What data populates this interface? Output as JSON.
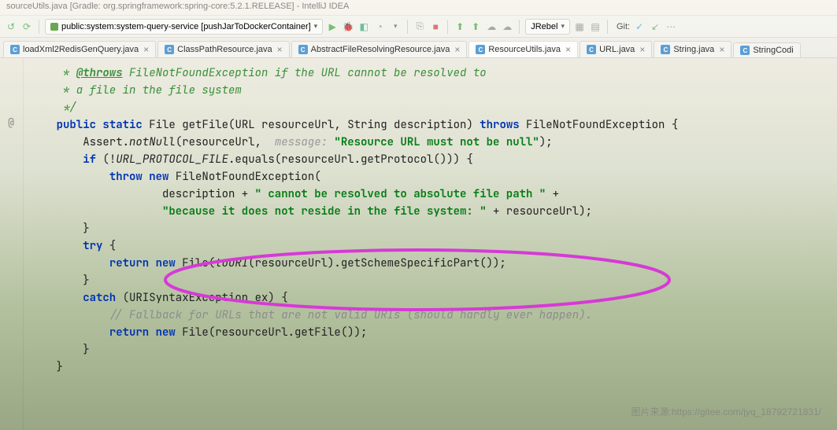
{
  "window": {
    "title": "sourceUtils.java [Gradle: org.springframework:spring-core:5.2.1.RELEASE] - IntelliJ IDEA"
  },
  "toolbar": {
    "run_config": "public:system:system-query-service [pushJarToDockerContainer]",
    "jrebel": "JRebel",
    "git_label": "Git:"
  },
  "tabs": [
    {
      "name": "loadXml2RedisGenQuery.java",
      "active": false
    },
    {
      "name": "ClassPathResource.java",
      "active": false
    },
    {
      "name": "AbstractFileResolvingResource.java",
      "active": false
    },
    {
      "name": "ResourceUtils.java",
      "active": true
    },
    {
      "name": "URL.java",
      "active": false
    },
    {
      "name": "String.java",
      "active": false
    },
    {
      "name": "StringCodi",
      "active": false
    }
  ],
  "code": {
    "l0": "     * ",
    "l0_tag": "@throws",
    "l0_b": " FileNotFoundException ",
    "l0_c": "if the URL cannot be resolved to",
    "l1": "     * a file in the file system",
    "l2": "     */",
    "l3_a": "    ",
    "l3_public": "public",
    "l3_static": "static",
    "l3_type": "File",
    "l3_name": " getFile(URL resourceUrl, String description) ",
    "l3_throws": "throws",
    "l3_ex": " FileNotFoundException {",
    "l4_a": "        Assert.",
    "l4_b": "notNull",
    "l4_c": "(resourceUrl,  ",
    "l4_hint": "message:",
    "l4_str": "\"Resource URL must not be null\"",
    "l4_d": ");",
    "l5_a": "        ",
    "l5_if": "if",
    "l5_b": " (!",
    "l5_c": "URL_PROTOCOL_FILE",
    "l5_d": ".equals(resourceUrl.getProtocol())) {",
    "l6_a": "            ",
    "l6_throw": "throw",
    "l6_new": "new",
    "l6_b": " FileNotFoundException(",
    "l7_a": "                    description + ",
    "l7_str": "\" cannot be resolved to absolute file path \"",
    "l7_b": " +",
    "l8_a": "                    ",
    "l8_str": "\"because it does not reside in the file system: \"",
    "l8_b": " + resourceUrl);",
    "l9": "        }",
    "l10_a": "        ",
    "l10_try": "try",
    "l10_b": " {",
    "l11_a": "            ",
    "l11_ret": "return",
    "l11_new": "new",
    "l11_b": " File(",
    "l11_c": "toURI",
    "l11_d": "(resourceUrl).getSchemeSpecificPart());",
    "l12": "        }",
    "l13_a": "        ",
    "l13_catch": "catch",
    "l13_b": " (URISyntaxException ex) {",
    "l14_a": "            ",
    "l14_c": "// Fallback for URLs that are not valid URIs (should hardly ever happen).",
    "l15_a": "            ",
    "l15_ret": "return",
    "l15_new": "new",
    "l15_b": " File(resourceUrl.getFile());",
    "l16": "        }",
    "l17": "    }"
  },
  "watermark": "图片来源:https://gitee.com/jyq_18792721831/"
}
